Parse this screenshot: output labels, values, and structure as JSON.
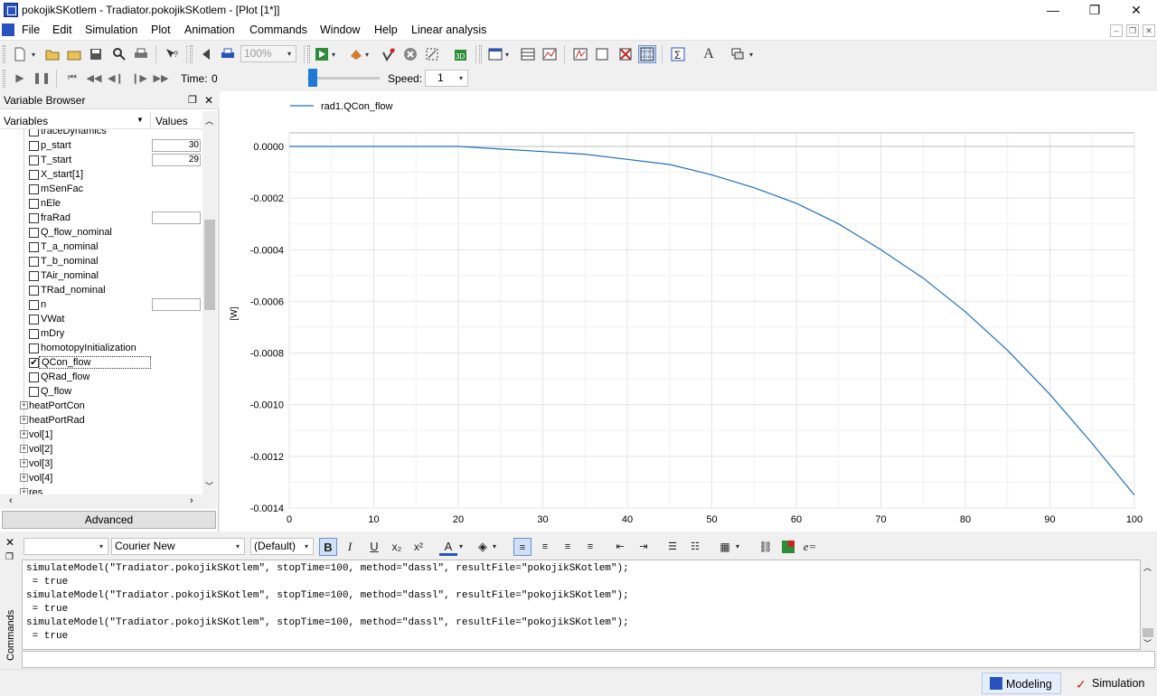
{
  "window": {
    "title": "pokojikSKotlem - Tradiator.pokojikSKotlem - [Plot [1*]]",
    "minimize": "—",
    "maximize": "❐",
    "close": "✕"
  },
  "menu": {
    "items": [
      "File",
      "Edit",
      "Simulation",
      "Plot",
      "Animation",
      "Commands",
      "Window",
      "Help",
      "Linear analysis"
    ]
  },
  "toolbar": {
    "zoom_value": "100%"
  },
  "animation_bar": {
    "time_label": "Time:",
    "time_value": "0",
    "speed_label": "Speed:",
    "speed_value": "1"
  },
  "variable_browser": {
    "title": "Variable Browser",
    "col_variables": "Variables",
    "col_values": "Values",
    "rows": [
      {
        "label": "traceDynamics",
        "type": "check",
        "checked": false,
        "value": ""
      },
      {
        "label": "p_start",
        "type": "check",
        "checked": false,
        "value": "30"
      },
      {
        "label": "T_start",
        "type": "check",
        "checked": false,
        "value": "29"
      },
      {
        "label": "X_start[1]",
        "type": "check",
        "checked": false,
        "value": ""
      },
      {
        "label": "mSenFac",
        "type": "check",
        "checked": false,
        "value": ""
      },
      {
        "label": "nEle",
        "type": "check",
        "checked": false,
        "value": ""
      },
      {
        "label": "fraRad",
        "type": "check",
        "checked": false,
        "value": " "
      },
      {
        "label": "Q_flow_nominal",
        "type": "check",
        "checked": false,
        "value": ""
      },
      {
        "label": "T_a_nominal",
        "type": "check",
        "checked": false,
        "value": ""
      },
      {
        "label": "T_b_nominal",
        "type": "check",
        "checked": false,
        "value": ""
      },
      {
        "label": "TAir_nominal",
        "type": "check",
        "checked": false,
        "value": ""
      },
      {
        "label": "TRad_nominal",
        "type": "check",
        "checked": false,
        "value": ""
      },
      {
        "label": "n",
        "type": "check",
        "checked": false,
        "value": " "
      },
      {
        "label": "VWat",
        "type": "check",
        "checked": false,
        "value": ""
      },
      {
        "label": "mDry",
        "type": "check",
        "checked": false,
        "value": ""
      },
      {
        "label": "homotopyInitialization",
        "type": "check",
        "checked": false,
        "value": ""
      },
      {
        "label": "QCon_flow",
        "type": "check",
        "checked": true,
        "value": ""
      },
      {
        "label": "QRad_flow",
        "type": "check",
        "checked": false,
        "value": ""
      },
      {
        "label": "Q_flow",
        "type": "check",
        "checked": false,
        "value": ""
      },
      {
        "label": "heatPortCon",
        "type": "expand",
        "checked": false,
        "value": ""
      },
      {
        "label": "heatPortRad",
        "type": "expand",
        "checked": false,
        "value": ""
      },
      {
        "label": "vol[1]",
        "type": "expand",
        "checked": false,
        "value": ""
      },
      {
        "label": "vol[2]",
        "type": "expand",
        "checked": false,
        "value": ""
      },
      {
        "label": "vol[3]",
        "type": "expand",
        "checked": false,
        "value": ""
      },
      {
        "label": "vol[4]",
        "type": "expand",
        "checked": false,
        "value": ""
      },
      {
        "label": "res",
        "type": "expand",
        "checked": false,
        "value": ""
      }
    ],
    "advanced_label": "Advanced"
  },
  "chart_data": {
    "type": "line",
    "title": "",
    "xlabel": "",
    "ylabel": "[W]",
    "xlim": [
      0,
      100
    ],
    "ylim": [
      -0.0014,
      0.0001
    ],
    "xticks": [
      "0",
      "10",
      "20",
      "30",
      "40",
      "50",
      "60",
      "70",
      "80",
      "90",
      "100"
    ],
    "yticks": [
      "0.0000",
      "-0.0002",
      "-0.0004",
      "-0.0006",
      "-0.0008",
      "-0.0010",
      "-0.0012",
      "-0.0014"
    ],
    "ytick_values": [
      0,
      -0.0002,
      -0.0004,
      -0.0006,
      -0.0008,
      -0.001,
      -0.0012,
      -0.0014
    ],
    "grid": true,
    "legend_position": "top-left",
    "series": [
      {
        "name": "rad1.QCon_flow",
        "color": "#1f6fbf",
        "x": [
          0,
          5,
          10,
          15,
          20,
          25,
          30,
          35,
          40,
          45,
          50,
          55,
          60,
          65,
          70,
          75,
          80,
          85,
          90,
          95,
          100
        ],
        "y": [
          0,
          0,
          0,
          0,
          0,
          -1e-05,
          -2e-05,
          -3e-05,
          -5e-05,
          -7e-05,
          -0.00011,
          -0.00016,
          -0.00022,
          -0.0003,
          -0.0004,
          -0.00051,
          -0.00064,
          -0.00079,
          -0.00096,
          -0.00115,
          -0.00135
        ]
      }
    ]
  },
  "command_panel": {
    "side_label": "Commands",
    "font_name": "Courier New",
    "font_size": "(Default)",
    "lines": [
      "simulateModel(\"Tradiator.pokojikSKotlem\", stopTime=100, method=\"dassl\", resultFile=\"pokojikSKotlem\");",
      " = true",
      "simulateModel(\"Tradiator.pokojikSKotlem\", stopTime=100, method=\"dassl\", resultFile=\"pokojikSKotlem\");",
      " = true",
      "simulateModel(\"Tradiator.pokojikSKotlem\", stopTime=100, method=\"dassl\", resultFile=\"pokojikSKotlem\");",
      " = true"
    ]
  },
  "status": {
    "modeling_label": "Modeling",
    "simulation_label": "Simulation"
  }
}
